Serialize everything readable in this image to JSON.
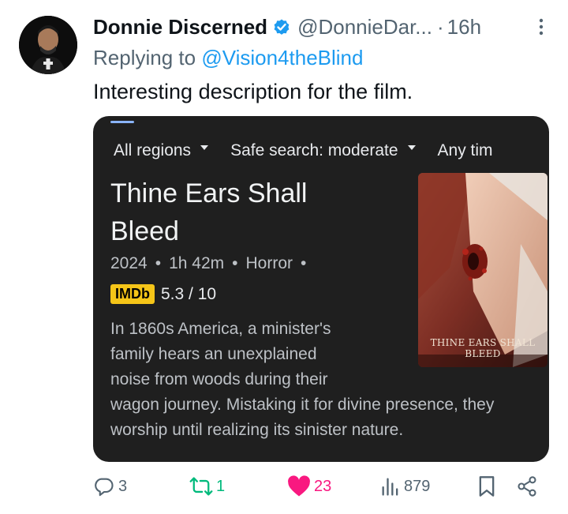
{
  "tweet": {
    "author": {
      "display_name": "Donnie Discerned",
      "handle": "@DonnieDar...",
      "separator": "·",
      "time": "16h"
    },
    "replying_prefix": "Replying to ",
    "replying_to": "@Vision4theBlind",
    "text": "Interesting description for the film."
  },
  "card": {
    "filters": [
      {
        "label": "All regions"
      },
      {
        "label": "Safe search: moderate"
      },
      {
        "label": "Any tim"
      }
    ],
    "title_lines": [
      "Thine Ears Shall",
      "Bleed"
    ],
    "year": "2024",
    "duration": "1h 42m",
    "genre": "Horror",
    "bullet": "•",
    "imdb_label": "IMDb",
    "rating": "5.3 / 10",
    "description_lines": [
      "In 1860s America, a minister's",
      "family hears an unexplained",
      "noise from woods during their",
      "wagon journey. Mistaking it for divine presence, they",
      "worship until realizing its sinister nature."
    ],
    "poster_title": "THINE EARS SHALL BLEED"
  },
  "actions": {
    "replies": "3",
    "reposts": "1",
    "likes": "23",
    "views": "879"
  },
  "colors": {
    "accent_blue": "#1d9bf0",
    "secondary_text": "#536471",
    "like_pink": "#f91880",
    "repost_green": "#00ba7c",
    "card_bg": "#1f1f1f",
    "imdb_yellow": "#f5c518"
  },
  "icons": [
    "verified-badge-icon",
    "more-icon",
    "caret-down-icon",
    "reply-icon",
    "repost-icon",
    "like-icon",
    "views-icon",
    "bookmark-icon",
    "share-icon"
  ]
}
